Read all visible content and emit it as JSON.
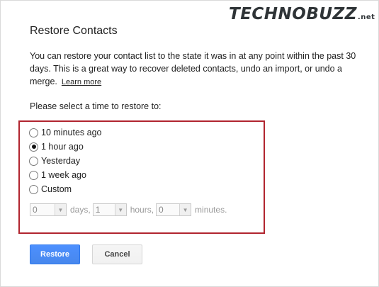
{
  "watermark": {
    "main": "TECHNOBUZZ",
    "tld": ".net"
  },
  "dialog": {
    "title": "Restore Contacts",
    "description": "You can restore your contact list to the state it was in at any point within the past 30 days. This is a great way to recover deleted contacts, undo an import, or undo a merge.",
    "learn_more": "Learn more",
    "prompt": "Please select a time to restore to:"
  },
  "options": [
    {
      "label": "10 minutes ago",
      "checked": false
    },
    {
      "label": "1 hour ago",
      "checked": true
    },
    {
      "label": "Yesterday",
      "checked": false
    },
    {
      "label": "1 week ago",
      "checked": false
    },
    {
      "label": "Custom",
      "checked": false
    }
  ],
  "custom": {
    "days_value": "0",
    "days_label": "days,",
    "hours_value": "1",
    "hours_label": "hours,",
    "minutes_value": "0",
    "minutes_label": "minutes."
  },
  "buttons": {
    "restore": "Restore",
    "cancel": "Cancel"
  },
  "colors": {
    "highlight_border": "#b1252f",
    "primary_button": "#4d90fe"
  }
}
